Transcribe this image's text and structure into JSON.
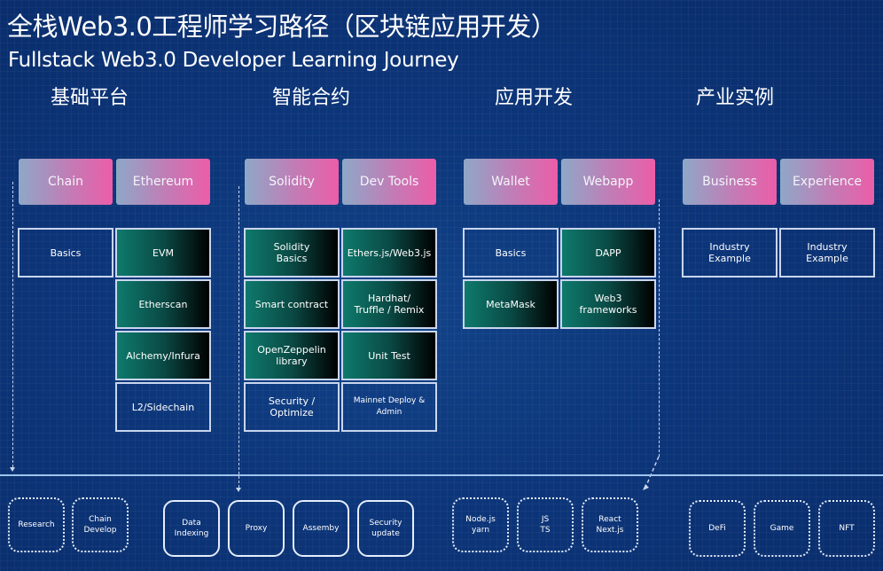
{
  "title": "全栈Web3.0工程师学习路径（区块链应用开发）",
  "subtitle": "Fullstack Web3.0 Developer Learning Journey",
  "categories": [
    {
      "label": "基础平台"
    },
    {
      "label": "智能合约"
    },
    {
      "label": "应用开发"
    },
    {
      "label": "产业实例"
    }
  ],
  "headers": [
    {
      "label": "Chain"
    },
    {
      "label": "Ethereum"
    },
    {
      "label": "Solidity"
    },
    {
      "label": "Dev Tools"
    },
    {
      "label": "Wallet"
    },
    {
      "label": "Webapp"
    },
    {
      "label": "Business"
    },
    {
      "label": "Experience"
    }
  ],
  "topics": {
    "chain": [
      "Basics"
    ],
    "ethereum": [
      "EVM",
      "Etherscan",
      "Alchemy/Infura",
      "L2/Sidechain"
    ],
    "solidity": [
      "Solidity\nBasics",
      "Smart contract",
      "OpenZeppelin\nlibrary",
      "Security / Optimize"
    ],
    "devtools": [
      "Ethers.js/Web3.js",
      "Hardhat/\nTruffle / Remix",
      "Unit Test",
      "Mainnet Deploy & Admin"
    ],
    "wallet": [
      "Basics",
      "MetaMask"
    ],
    "webapp": [
      "DAPP",
      "Web3\nframeworks"
    ],
    "business": [
      "Industry\nExample"
    ],
    "experience": [
      "Industry\nExample"
    ]
  },
  "advanced": {
    "platform": [
      "Research",
      "Chain\nDevelop"
    ],
    "contracts": [
      "Data\nIndexing",
      "Proxy",
      "Assemby",
      "Security\nupdate"
    ],
    "apps": [
      "Node.js\nyarn",
      "JS\nTS",
      "React\nNext.js"
    ],
    "industry": [
      "DeFi",
      "Game",
      "NFT"
    ]
  },
  "colors": {
    "background": "#0c3579",
    "header_gradient_start": "#8ea8c8",
    "header_gradient_end": "#ec5da8",
    "dark_box_start": "#0e7a6c",
    "dark_box_end": "#000000",
    "border": "#c9d6ee"
  }
}
